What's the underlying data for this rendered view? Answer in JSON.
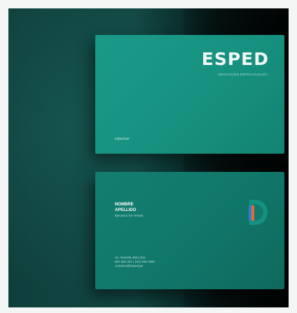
{
  "front": {
    "logo": "ESPED",
    "tagline": "EDUCACIÓN ESPECIALIZADA",
    "url": "esped.pe"
  },
  "back": {
    "first_name": "NOMBRE",
    "last_name": "APELLIDO",
    "job_title": "Ejecutivo De Ventas",
    "address": "Av. Avenida 456 Lima",
    "phones": "987 654 321 | (01) 456 7890",
    "email": "contacto@esped.pe"
  },
  "colors": {
    "card_teal": "#17917f",
    "logo_blue": "#2a7fd6",
    "logo_orange": "#e86a2c",
    "background": "#0f3f3c"
  }
}
